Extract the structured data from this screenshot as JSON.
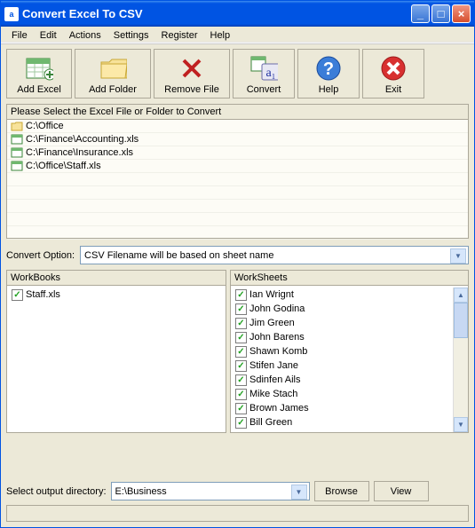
{
  "titlebar": {
    "title": "Convert Excel To CSV"
  },
  "menu": [
    "File",
    "Edit",
    "Actions",
    "Settings",
    "Register",
    "Help"
  ],
  "toolbar": [
    {
      "label": "Add Excel",
      "icon": "excel"
    },
    {
      "label": "Add Folder",
      "icon": "folder"
    },
    {
      "label": "Remove File",
      "icon": "remove"
    },
    {
      "label": "Convert",
      "icon": "convert"
    },
    {
      "label": "Help",
      "icon": "help"
    },
    {
      "label": "Exit",
      "icon": "exit"
    }
  ],
  "filelist": {
    "header": "Please Select the Excel File or Folder to Convert",
    "items": [
      {
        "type": "folder",
        "path": "C:\\Office"
      },
      {
        "type": "file",
        "path": "C:\\Finance\\Accounting.xls"
      },
      {
        "type": "file",
        "path": "C:\\Finance\\Insurance.xls"
      },
      {
        "type": "file",
        "path": "C:\\Office\\Staff.xls"
      }
    ]
  },
  "convert_option": {
    "label": "Convert Option:",
    "value": "CSV Filename will be based on sheet name"
  },
  "workbooks": {
    "header": "WorkBooks",
    "items": [
      {
        "name": "Staff.xls",
        "checked": true
      }
    ]
  },
  "worksheets": {
    "header": "WorkSheets",
    "items": [
      {
        "name": "Ian Wrignt",
        "checked": true
      },
      {
        "name": "John Godina",
        "checked": true
      },
      {
        "name": "Jim Green",
        "checked": true
      },
      {
        "name": "John Barens",
        "checked": true
      },
      {
        "name": "Shawn Komb",
        "checked": true
      },
      {
        "name": "Stifen Jane",
        "checked": true
      },
      {
        "name": "Sdinfen Ails",
        "checked": true
      },
      {
        "name": "Mike Stach",
        "checked": true
      },
      {
        "name": "Brown James",
        "checked": true
      },
      {
        "name": "Bill Green",
        "checked": true
      }
    ]
  },
  "output": {
    "label": "Select  output directory:",
    "value": "E:\\Business",
    "browse": "Browse",
    "view": "View"
  }
}
